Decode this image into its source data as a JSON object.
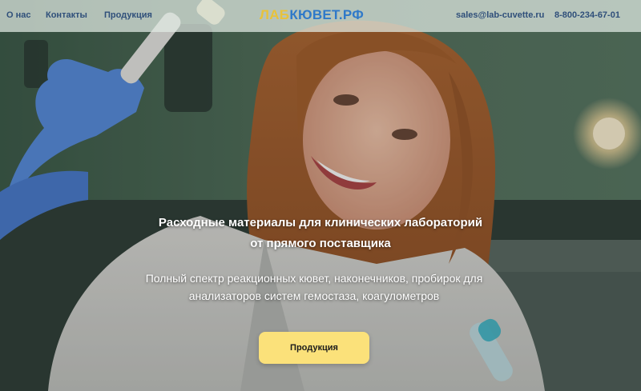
{
  "header": {
    "nav": [
      {
        "label": "О нас"
      },
      {
        "label": "Контакты"
      },
      {
        "label": "Продукция"
      }
    ],
    "logo": {
      "part1": "ЛАБ",
      "part2": "КЮВЕТ.РФ"
    },
    "email": "sales@lab-cuvette.ru",
    "phone": "8-800-234-67-01"
  },
  "hero": {
    "title_line1": "Расходные материалы для клинических лабораторий",
    "title_line2": "от прямого поставщика",
    "subtitle_line1": "Полный спектр реакционных кювет, наконечников, пробирок для",
    "subtitle_line2": "анализаторов систем гемостаза, коагулометров",
    "cta_label": "Продукция"
  },
  "colors": {
    "header_bg": "#e2ece4",
    "nav_text": "#2f4f7a",
    "logo_accent_yellow": "#e8c23a",
    "logo_accent_blue": "#2f79c9",
    "cta_bg": "#fbe17a"
  }
}
